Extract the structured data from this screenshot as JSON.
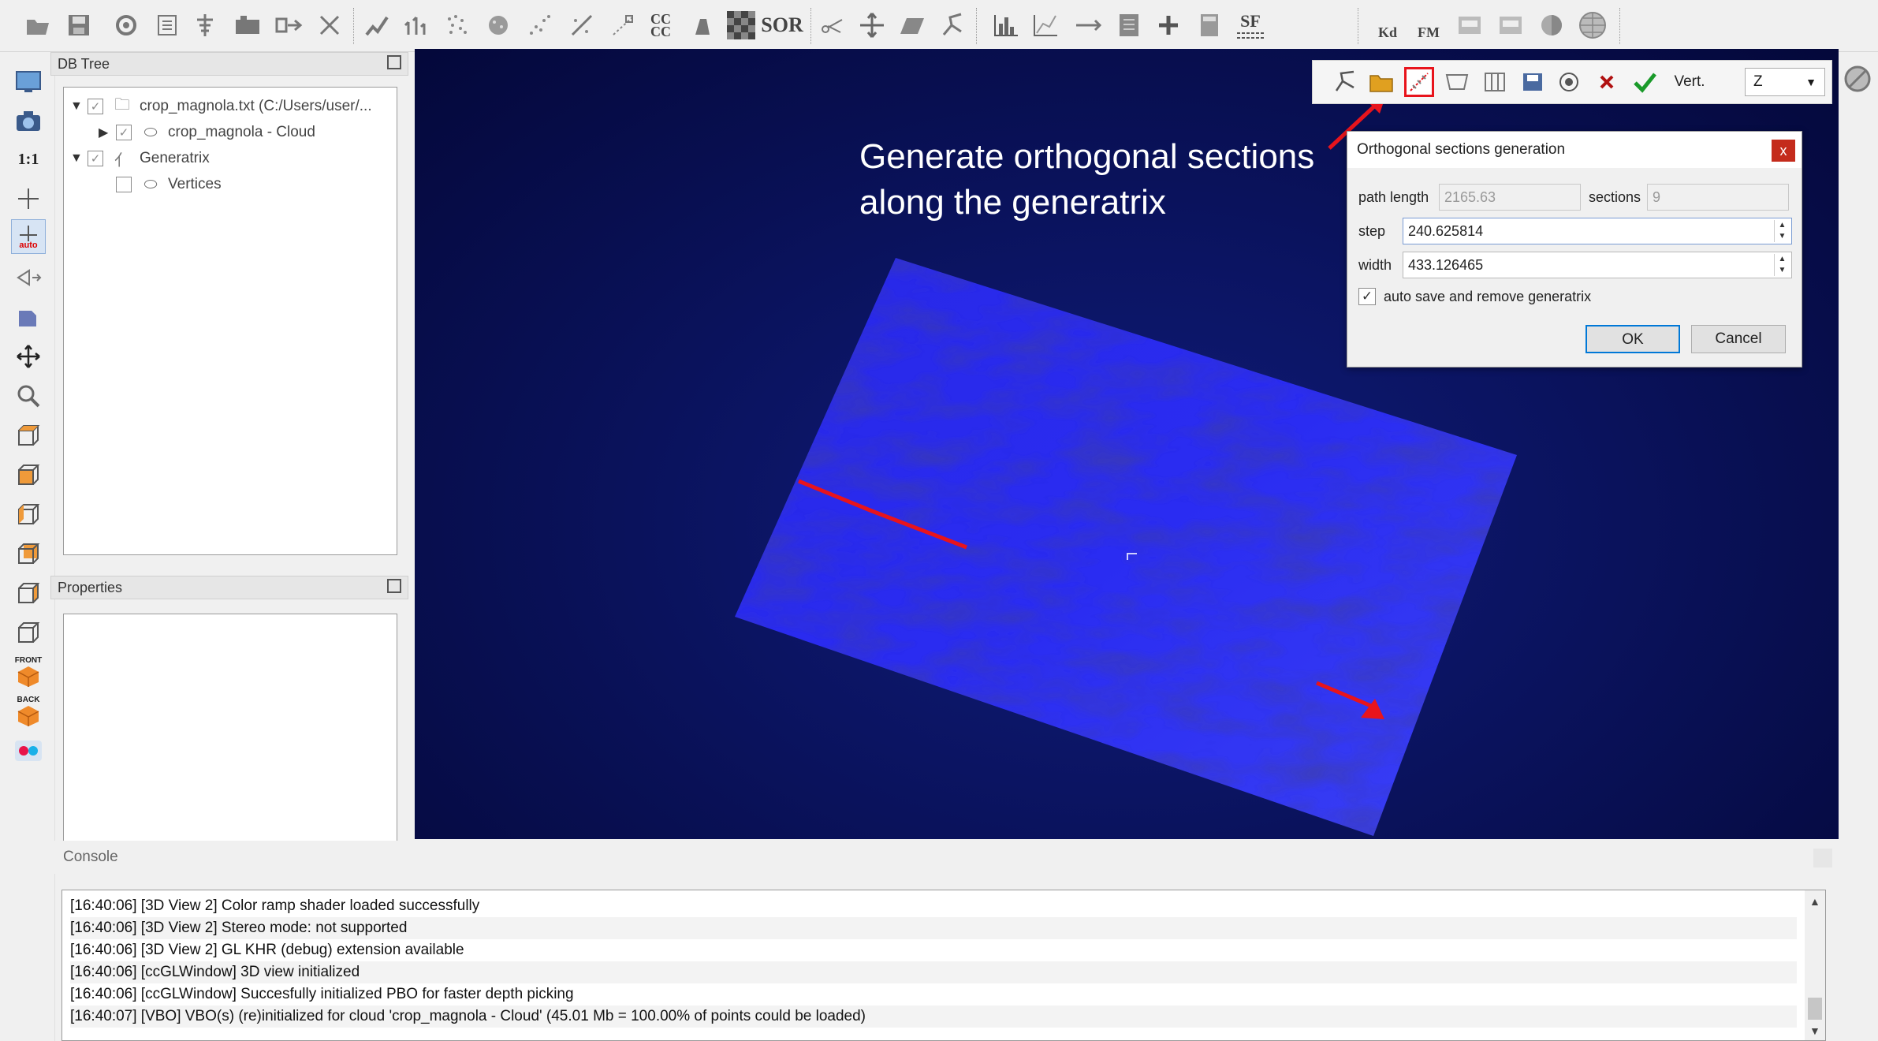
{
  "colors": {
    "accent_red": "#e8141c",
    "cloud_blue": "#2222f0",
    "view_bg": "#070d52",
    "close_red": "#c42b1c"
  },
  "top_toolbar": {
    "icons": [
      "open-icon",
      "save-icon",
      "settings-icon",
      "list-icon",
      "tree-icon",
      "merge-icon",
      "export-icon",
      "delete-icon",
      "clone-icon",
      "normals-icon",
      "sample-icon",
      "noise-icon",
      "scatter-icon",
      "resample-icon",
      "cc-icon",
      "compare-icon",
      "checker-icon",
      "sor-icon",
      "scissors-icon",
      "move-icon",
      "plane-icon",
      "generatrix-icon",
      "histogram-icon",
      "plot-icon",
      "minmax-icon",
      "filter-icon",
      "add-icon",
      "calc-icon",
      "sf-icon",
      "kd-icon",
      "fm-icon",
      "save-view-icon",
      "load-view-icon",
      "sphere-icon",
      "globe-icon"
    ],
    "cc_label": "CC\nCC",
    "sor_label": "SOR",
    "sf_label": "SF",
    "kd_label": "Kd",
    "fm_label": "FM"
  },
  "left_toolbar": {
    "icons": [
      "display-icon",
      "camera-icon",
      "ratio-icon",
      "pivot-icon",
      "auto-pivot-icon",
      "perspective-icon",
      "object-icon",
      "move-icon",
      "zoom-icon",
      "top-view-icon",
      "front-view-icon",
      "left-view-icon",
      "back-view-icon",
      "right-view-icon",
      "bottom-view-icon",
      "front-iso-icon",
      "back-iso-icon",
      "stereo-icon"
    ],
    "ratio_label": "1:1",
    "auto_label": "auto",
    "front_label": "FRONT",
    "back_label": "BACK"
  },
  "db_tree": {
    "title": "DB Tree",
    "items": [
      {
        "label": "crop_magnola.txt (C:/Users/user/..."
      },
      {
        "label": "crop_magnola - Cloud"
      },
      {
        "label": "Generatrix"
      },
      {
        "label": "Vertices"
      }
    ]
  },
  "properties": {
    "title": "Properties"
  },
  "annotation": {
    "line1": "Generate orthogonal sections",
    "line2": "along the generatrix"
  },
  "section_toolbar": {
    "vert_label": "Vert.",
    "axis_value": "Z"
  },
  "dialog": {
    "title": "Orthogonal sections generation",
    "close": "x",
    "path_length_label": "path length",
    "path_length_value": "2165.63",
    "sections_label": "sections",
    "sections_value": "9",
    "step_label": "step",
    "step_value": "240.625814",
    "width_label": "width",
    "width_value": "433.126465",
    "auto_save_label": "auto save and remove generatrix",
    "auto_save_checked": true,
    "ok": "OK",
    "cancel": "Cancel"
  },
  "console": {
    "title": "Console",
    "lines": [
      "[16:40:06] [3D View 2] Color ramp shader loaded successfully",
      "[16:40:06] [3D View 2] Stereo mode: not supported",
      "[16:40:06] [3D View 2] GL KHR (debug) extension available",
      "[16:40:06] [ccGLWindow] 3D view initialized",
      "[16:40:06] [ccGLWindow] Succesfully initialized PBO for faster depth picking",
      "[16:40:07] [VBO] VBO(s) (re)initialized for cloud 'crop_magnola - Cloud' (45.01 Mb = 100.00% of points could be loaded)"
    ]
  }
}
